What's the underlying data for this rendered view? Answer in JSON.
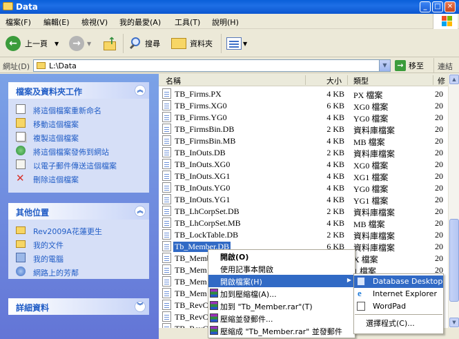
{
  "window": {
    "title": "Data"
  },
  "menubar": [
    "檔案(F)",
    "編輯(E)",
    "檢視(V)",
    "我的最愛(A)",
    "工具(T)",
    "說明(H)"
  ],
  "toolbar": {
    "back": "上一頁",
    "search": "搜尋",
    "folders": "資料夾"
  },
  "address": {
    "label": "網址(D)",
    "value": "L:\\Data",
    "go": "移至",
    "links": "連結"
  },
  "tasks_panel": {
    "title": "檔案及資料夾工作",
    "items": [
      "將這個檔案重新命名",
      "移動這個檔案",
      "複製這個檔案",
      "將這個檔案發佈到網站",
      "以電子郵件傳送這個檔案",
      "刪除這個檔案"
    ]
  },
  "places_panel": {
    "title": "其他位置",
    "items": [
      "Rev2009A花蓮更生",
      "我的文件",
      "我的電腦",
      "網路上的芳鄰"
    ]
  },
  "details_panel": {
    "title": "詳細資料"
  },
  "columns": {
    "name": "名稱",
    "size": "大小",
    "type": "類型",
    "date": "修"
  },
  "files": [
    {
      "name": "TB_Firms.PX",
      "size": "4 KB",
      "type": "PX 檔案",
      "date": "20"
    },
    {
      "name": "TB_Firms.XG0",
      "size": "6 KB",
      "type": "XG0 檔案",
      "date": "20"
    },
    {
      "name": "TB_Firms.YG0",
      "size": "4 KB",
      "type": "YG0 檔案",
      "date": "20"
    },
    {
      "name": "TB_FirmsBin.DB",
      "size": "2 KB",
      "type": "資料庫檔案",
      "date": "20"
    },
    {
      "name": "TB_FirmsBin.MB",
      "size": "4 KB",
      "type": "MB 檔案",
      "date": "20"
    },
    {
      "name": "TB_InOuts.DB",
      "size": "2 KB",
      "type": "資料庫檔案",
      "date": "20"
    },
    {
      "name": "TB_InOuts.XG0",
      "size": "4 KB",
      "type": "XG0 檔案",
      "date": "20"
    },
    {
      "name": "TB_InOuts.XG1",
      "size": "4 KB",
      "type": "XG1 檔案",
      "date": "20"
    },
    {
      "name": "TB_InOuts.YG0",
      "size": "4 KB",
      "type": "YG0 檔案",
      "date": "20"
    },
    {
      "name": "TB_InOuts.YG1",
      "size": "4 KB",
      "type": "YG1 檔案",
      "date": "20"
    },
    {
      "name": "TB_LhCorpSet.DB",
      "size": "2 KB",
      "type": "資料庫檔案",
      "date": "20"
    },
    {
      "name": "TB_LhCorpSet.MB",
      "size": "4 KB",
      "type": "MB 檔案",
      "date": "20"
    },
    {
      "name": "TB_LockTable.DB",
      "size": "2 KB",
      "type": "資料庫檔案",
      "date": "20"
    },
    {
      "name": "Tb_Member.DB",
      "size": "6 KB",
      "type": "資料庫檔案",
      "date": "20"
    },
    {
      "name": "TB_Memb",
      "size": "",
      "type": "X 檔案",
      "date": "20"
    },
    {
      "name": "TB_Mem",
      "size": "",
      "type": "1 檔案",
      "date": "20"
    },
    {
      "name": "TB_Mem",
      "size": "",
      "type": "",
      "date": ""
    },
    {
      "name": "TB_Mem",
      "size": "",
      "type": "",
      "date": ""
    },
    {
      "name": "TB_RevC",
      "size": "",
      "type": "",
      "date": ""
    },
    {
      "name": "TB_RevC",
      "size": "",
      "type": "",
      "date": ""
    },
    {
      "name": "TB_RevC",
      "size": "",
      "type": "",
      "date": ""
    }
  ],
  "context_menu": {
    "items": [
      "開啟(O)",
      "使用記事本開啟",
      "開啟檔案(H)",
      "加到壓縮檔(A)...",
      "加到 \"Tb_Member.rar\"(T)",
      "壓縮並發郵件...",
      "壓縮成 \"Tb_Member.rar\" 並發郵件"
    ]
  },
  "open_with_menu": {
    "items": [
      "Database Desktop",
      "Internet Explorer",
      "WordPad",
      "選擇程式(C)..."
    ]
  }
}
